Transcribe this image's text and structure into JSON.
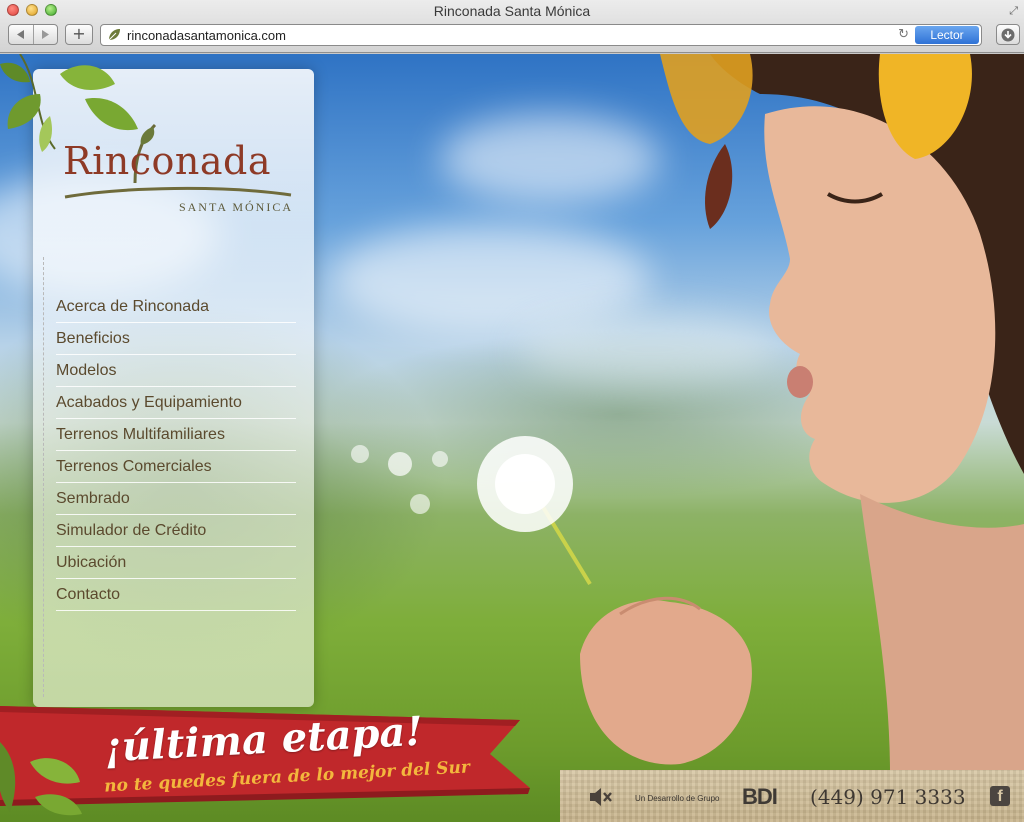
{
  "window": {
    "title": "Rinconada Santa Mónica"
  },
  "toolbar": {
    "back_icon": "back-arrow-icon",
    "forward_icon": "forward-arrow-icon",
    "new_tab_label": "+",
    "url": "rinconadasantamonica.com",
    "reader_label": "Lector"
  },
  "logo": {
    "word": "Rinconada",
    "subtitle": "SANTA MÓNICA"
  },
  "menu": {
    "items": [
      "Acerca de Rinconada",
      "Beneficios",
      "Modelos",
      "Acabados y Equipamiento",
      "Terrenos Multifamiliares",
      "Terrenos Comerciales",
      "Sembrado",
      "Simulador de Crédito",
      "Ubicación",
      "Contacto"
    ]
  },
  "banner": {
    "title": "¡última etapa!",
    "subtitle": "no te quedes fuera de lo mejor del Sur"
  },
  "footer": {
    "developer_text": "Un Desarrollo de Grupo",
    "developer_brand": "BDI",
    "phone": "(449) 971 3333",
    "facebook_glyph": "f"
  },
  "colors": {
    "logo_red": "#8e3a26",
    "menu_text": "#5b4a2e",
    "banner_red": "#c0282b",
    "banner_subtitle": "#f3b73d",
    "reader_blue": "#2f72d6"
  }
}
